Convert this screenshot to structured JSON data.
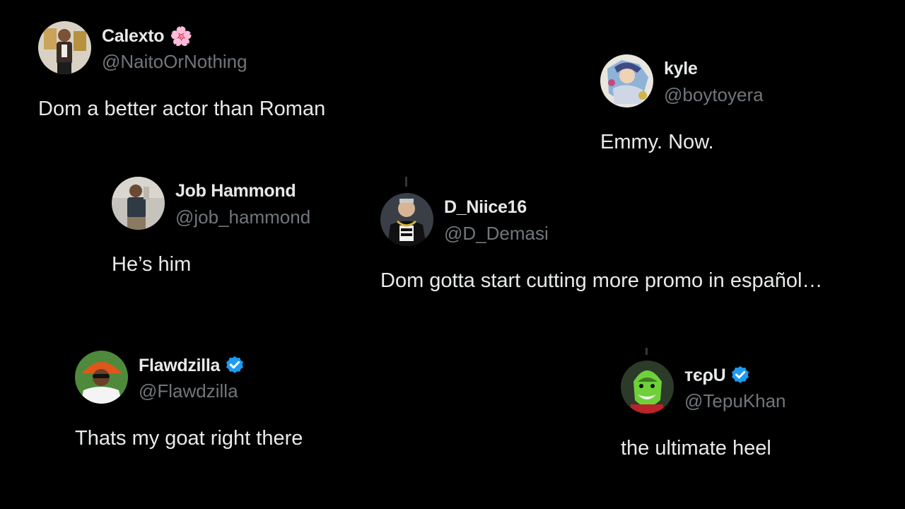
{
  "tweets": [
    {
      "name": "Calexto",
      "handle": "@NaitoOrNothing",
      "text": "Dom a better actor than Roman",
      "name_emoji": "🌸",
      "verified": false
    },
    {
      "name": "kyle",
      "handle": "@boytoyera",
      "text": "Emmy. Now.",
      "verified": false
    },
    {
      "name": "Job Hammond",
      "handle": "@job_hammond",
      "text": "He’s him",
      "verified": false
    },
    {
      "name": "D_Niice16",
      "handle": "@D_Demasi",
      "text": "Dom gotta start cutting more promo in español…",
      "verified": false
    },
    {
      "name": "Flawdzilla",
      "handle": "@Flawdzilla",
      "text": "Thats my goat right there",
      "verified": true
    },
    {
      "name": "тєρU",
      "handle": "@TepuKhan",
      "text": "the ultimate heel",
      "verified": true
    }
  ],
  "colors": {
    "background": "#000000",
    "name": "#e7e9ea",
    "handle": "#71767b",
    "verified": "#1d9bf0"
  }
}
